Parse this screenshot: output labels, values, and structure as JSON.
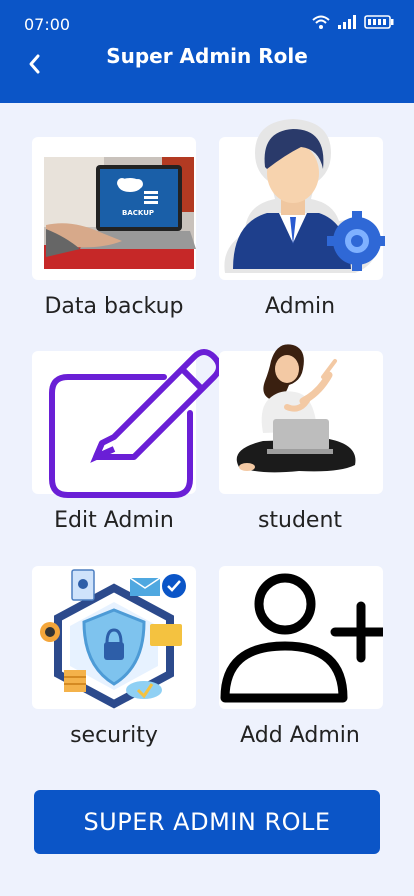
{
  "status_bar": {
    "time": "07:00"
  },
  "header": {
    "title": "Super Admin Role",
    "back_icon": "chevron-left-icon"
  },
  "tiles": [
    {
      "label": "Data backup",
      "image": "laptop-backup-illustration",
      "screen_text": "BACKUP"
    },
    {
      "label": "Admin",
      "image": "admin-avatar-gear-illustration"
    },
    {
      "label": "Edit Admin",
      "image": "edit-pencil-icon"
    },
    {
      "label": "student",
      "image": "student-laptop-illustration"
    },
    {
      "label": "security",
      "image": "security-shield-network-illustration"
    },
    {
      "label": "Add Admin",
      "image": "add-user-icon"
    }
  ],
  "cta": {
    "label": "SUPER ADMIN ROLE"
  },
  "colors": {
    "primary": "#0b55c7",
    "background": "#eef2fd",
    "edit_icon": "#6a1fd6"
  }
}
